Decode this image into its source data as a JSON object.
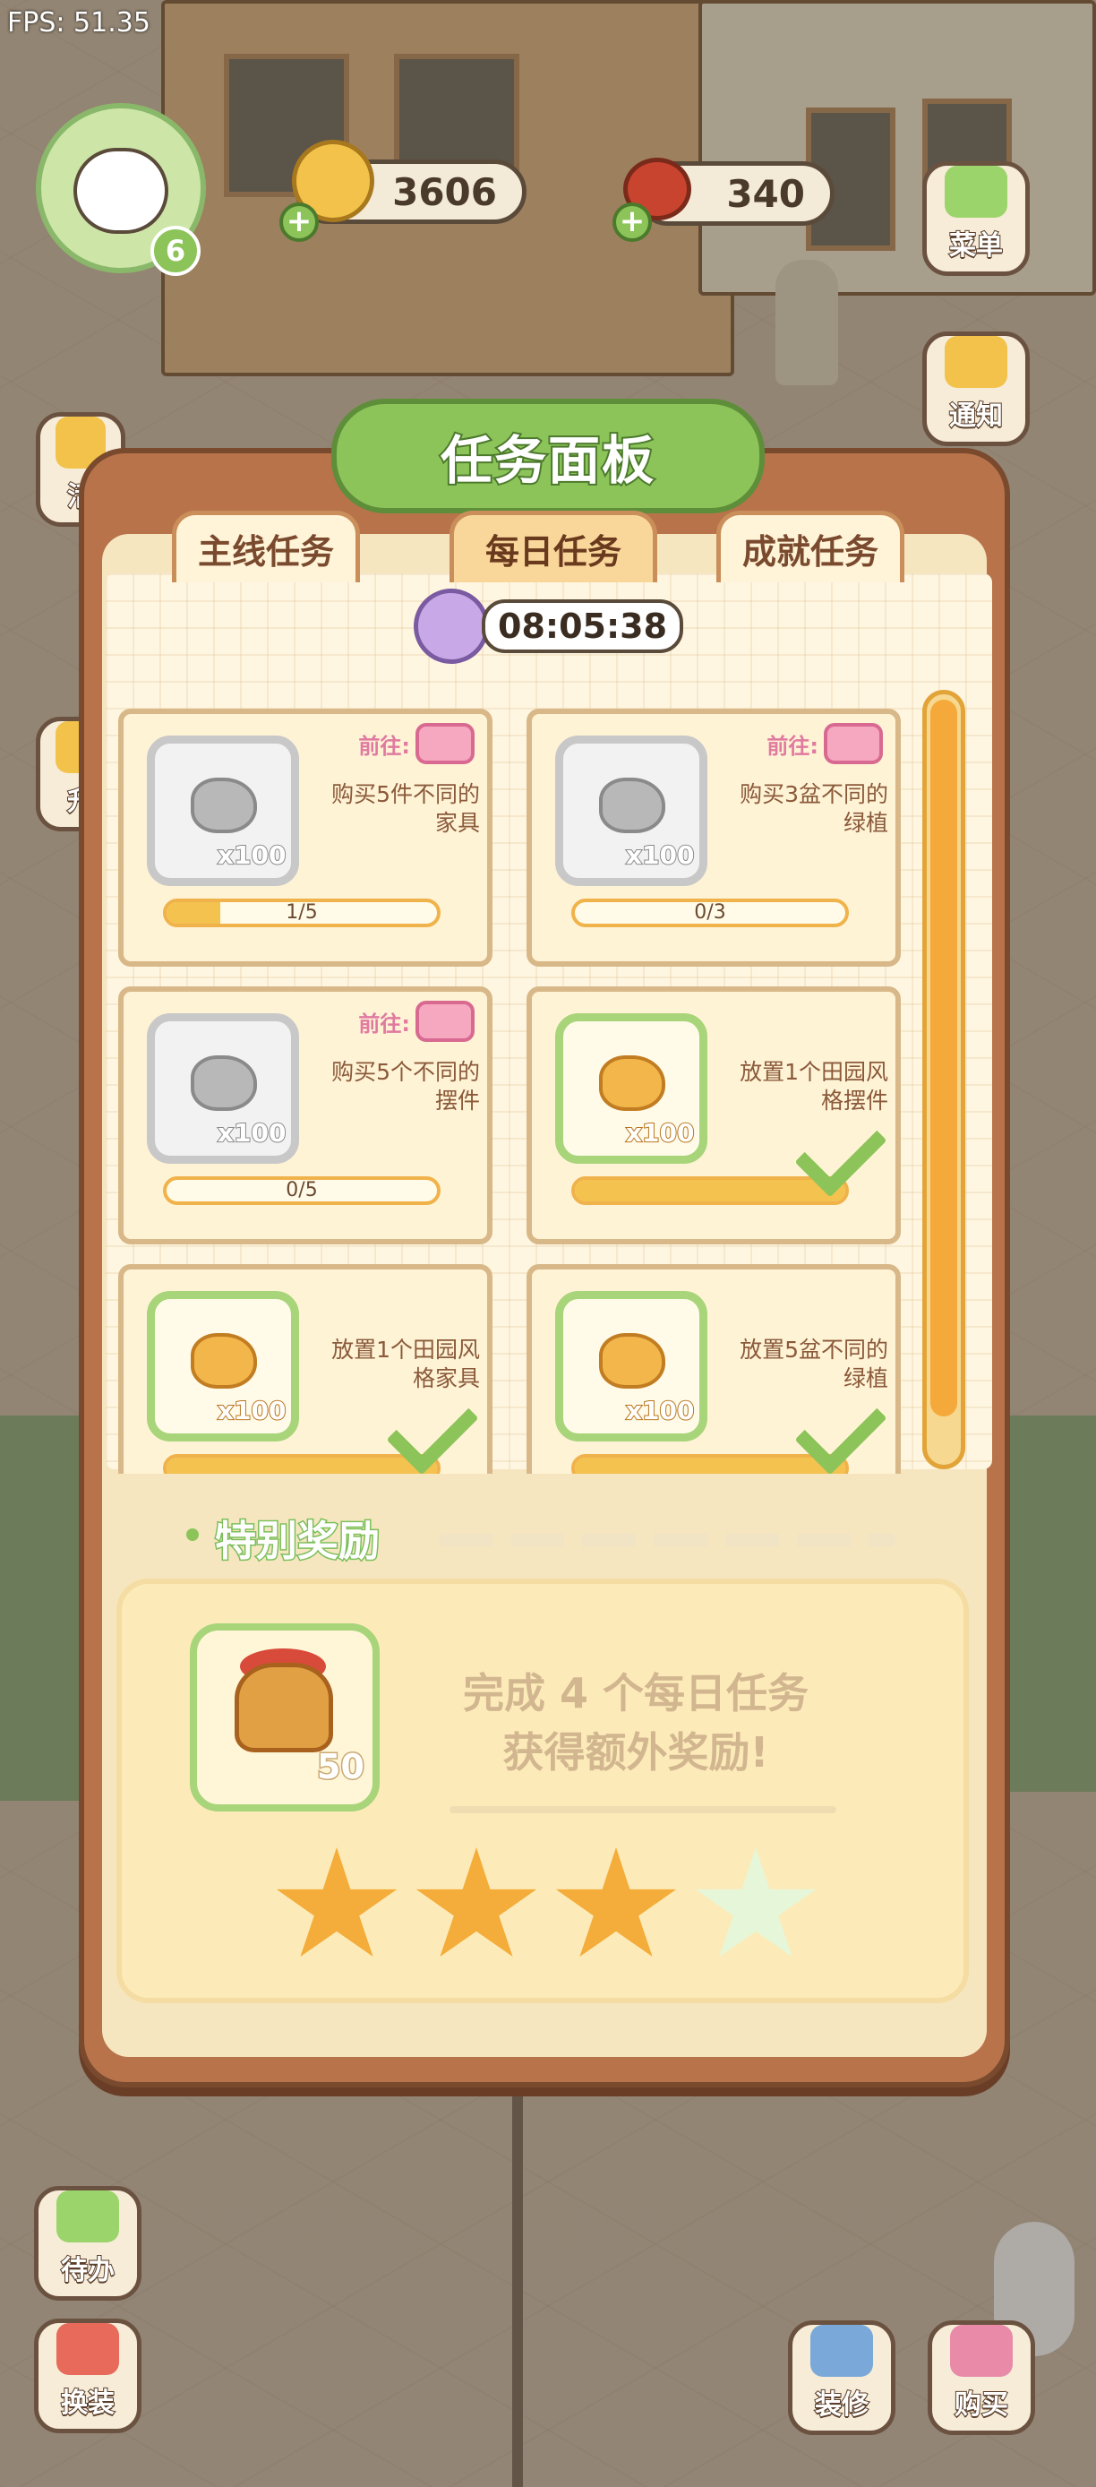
{
  "fps": "FPS: 51.35",
  "hud": {
    "level": "6",
    "coins": "3606",
    "carrots": "340"
  },
  "side_buttons": {
    "menu": "菜单",
    "notice": "通知",
    "activity": "活",
    "upgrade": "升",
    "todo": "待办",
    "dress": "换装",
    "decorate": "装修",
    "shop": "购买"
  },
  "panel": {
    "title": "任务面板",
    "tabs": [
      {
        "label": "主线任务",
        "active": false
      },
      {
        "label": "每日任务",
        "active": true
      },
      {
        "label": "成就任务",
        "active": false
      }
    ],
    "timer": "08:05:38"
  },
  "tasks": [
    {
      "desc": "购买5件不同的家具",
      "qty": "x100",
      "goto": "前往:",
      "progress_text": "1/5",
      "progress": 0.2,
      "done": false
    },
    {
      "desc": "购买3盆不同的绿植",
      "qty": "x100",
      "goto": "前往:",
      "progress_text": "0/3",
      "progress": 0.0,
      "done": false
    },
    {
      "desc": "购买5个不同的摆件",
      "qty": "x100",
      "goto": "前往:",
      "progress_text": "0/5",
      "progress": 0.0,
      "done": false
    },
    {
      "desc": "放置1个田园风格摆件",
      "qty": "x100",
      "progress_text": "",
      "progress": 1.0,
      "done": true
    },
    {
      "desc": "放置1个田园风格家具",
      "qty": "x100",
      "progress_text": "",
      "progress": 1.0,
      "done": true
    },
    {
      "desc": "放置5盆不同的绿植",
      "qty": "x100",
      "progress_text": "",
      "progress": 1.0,
      "done": true
    }
  ],
  "special": {
    "title": "特别奖励",
    "line1": "完成 4 个每日任务",
    "line2": "获得额外奖励!",
    "reward_count": "50",
    "stars_total": 4,
    "stars_filled": 3
  },
  "colors": {
    "panel_frame": "#b8734a",
    "title_green": "#8cc45a",
    "star_on": "#f4ac3a",
    "star_off": "#e6f6d8"
  }
}
